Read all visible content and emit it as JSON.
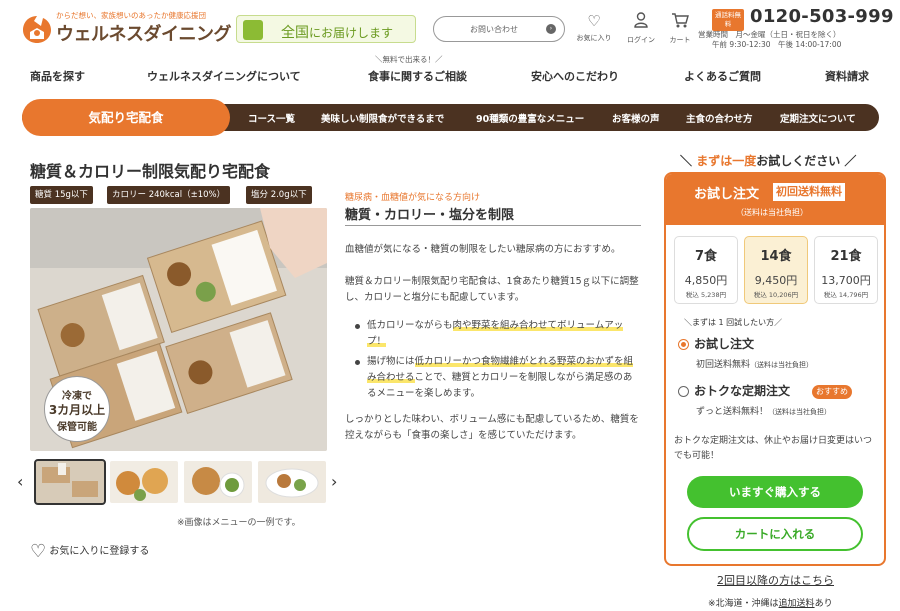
{
  "header": {
    "logo_tagline": "からだ想い、家族想いのあったか健康応援団",
    "logo_name": "ウェルネスダイニング",
    "nationwide_text_a": "全国",
    "nationwide_text_b": "にお届けします",
    "contact_label": "お問い合わせ",
    "icons": [
      {
        "icon": "heart-icon",
        "label": "お気に入り"
      },
      {
        "icon": "person-icon",
        "label": "ログイン"
      },
      {
        "icon": "cart-icon",
        "label": "カート"
      }
    ],
    "freecall_badge": "通話料無料",
    "phone": "0120-503-999",
    "hours_line1": "営業時間　月〜金曜（土日・祝日を除く）",
    "hours_line2": "午前 9:30-12:30　午後 14:00-17:00"
  },
  "nav": {
    "note": "＼無料で出来る！／",
    "items": [
      "商品を探す",
      "ウェルネスダイニングについて",
      "食事に関するご相談",
      "安心へのこだわり",
      "よくあるご質問",
      "資料請求"
    ]
  },
  "subnav": {
    "active": "気配り宅配食",
    "items": [
      "コース一覧",
      "美味しい制限食ができるまで",
      "90種類の豊富なメニュー",
      "お客様の声",
      "主食の合わせ方",
      "定期注文について"
    ]
  },
  "product": {
    "title": "糖質＆カロリー制限気配り宅配食",
    "tags": [
      "糖質 15g以下",
      "カロリー 240kcal（±10%）",
      "塩分 2.0g以下"
    ],
    "photo_badge": [
      "冷凍で",
      "3カ月以上",
      "保管可能"
    ],
    "photo_note": "※画像はメニューの一例です。",
    "favorite_label": "お気に入りに登録する"
  },
  "description": {
    "target": "糖尿病・血糖値が気になる方向け",
    "heading": "糖質・カロリー・塩分を制限",
    "para1": "血糖値が気になる・糖質の制限をしたい糖尿病の方におすすめ。",
    "para2": "糖質＆カロリー制限気配り宅配食は、1食あたり糖質15ｇ以下に調整し、カロリーと塩分にも配慮しています。",
    "bullet1_a": "低カロリーながらも",
    "bullet1_b": "肉や野菜を組み合わせてボリュームアップ！",
    "bullet2_a": "揚げ物には",
    "bullet2_b": "低カロリーかつ食物繊維がとれる野菜のおかずを組み合わせる",
    "bullet2_c": "ことで、糖質とカロリーを制限しながら満足感のあるメニューを楽しめます。",
    "para3": "しっかりとした味わい、ボリューム感にも配慮しているため、糖質を控えながらも「食事の楽しさ」を感じていただけます。"
  },
  "order": {
    "try_head_a": "＼",
    "try_head_b": "まずは一度",
    "try_head_c": "お試しください",
    "try_head_d": "／",
    "box_title": "お試し注文",
    "box_badge": "初回送料無料",
    "box_sub": "（送料は当社負担）",
    "plans": [
      {
        "name": "7食",
        "price": "4,850円",
        "tax": "税込 5,238円",
        "selected": false
      },
      {
        "name": "14食",
        "price": "9,450円",
        "tax": "税込 10,206円",
        "selected": true
      },
      {
        "name": "21食",
        "price": "13,700円",
        "tax": "税込 14,796円",
        "selected": false
      }
    ],
    "first_note": "＼まずは 1 回試したい方／",
    "opt1_label": "お試し注文",
    "opt1_sub": "初回送料無料",
    "opt1_sub_small": "（送料は当社負担）",
    "opt2_label": "おトクな定期注文",
    "opt2_badge": "おすすめ",
    "opt2_sub": "ずっと送料無料！",
    "opt2_sub_small": "（送料は当社負担）",
    "sub_note": "おトクな定期注文は、休止やお届け日変更はいつでも可能！",
    "buy_label": "いますぐ購入する",
    "cart_label": "カートに入れる",
    "second_link": "2回目以降の方はこちら",
    "bottom_note_a": "※北海道・沖縄は",
    "bottom_note_b": "追加送料",
    "bottom_note_c": "あり"
  },
  "colors": {
    "brand_orange": "#e8772e",
    "brand_brown": "#4b3221",
    "buy_green": "#44c12f"
  }
}
